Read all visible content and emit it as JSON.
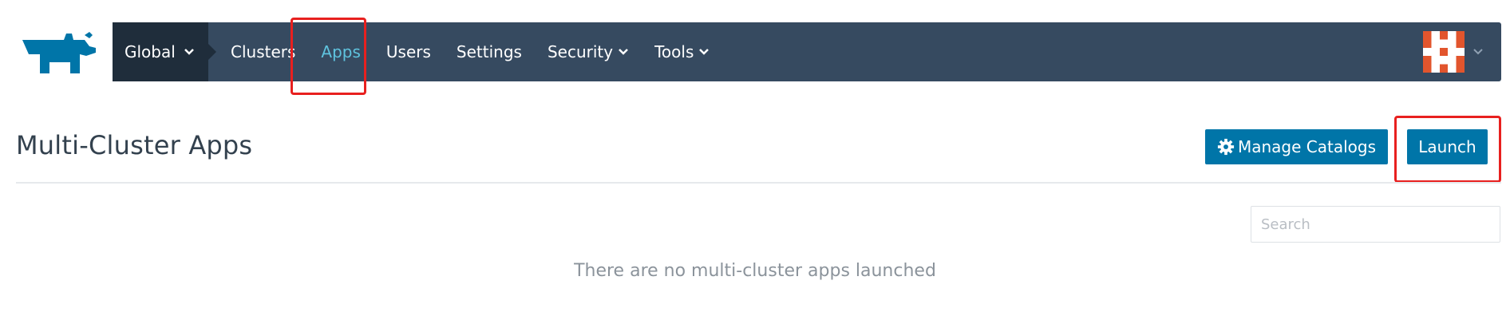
{
  "nav": {
    "global_label": "Global",
    "items": [
      {
        "label": "Clusters"
      },
      {
        "label": "Apps"
      },
      {
        "label": "Users"
      },
      {
        "label": "Settings"
      },
      {
        "label": "Security"
      },
      {
        "label": "Tools"
      }
    ],
    "active_item": "Apps"
  },
  "page": {
    "title": "Multi-Cluster Apps",
    "manage_catalogs_label": "Manage Catalogs",
    "launch_label": "Launch",
    "search_placeholder": "Search",
    "empty_message": "There are no multi-cluster apps launched"
  },
  "colors": {
    "nav_bg": "#364a60",
    "nav_global_bg": "#1f2d3b",
    "nav_active": "#5fc3de",
    "primary_button": "#0075a8",
    "logo": "#0075a8",
    "avatar_accent": "#e2552d",
    "highlight": "#e8201f"
  },
  "icons": {
    "logo": "rancher-cow-logo",
    "dropdown": "chevron-down-icon",
    "manage_catalogs": "gear-icon",
    "user": "identicon-avatar"
  }
}
